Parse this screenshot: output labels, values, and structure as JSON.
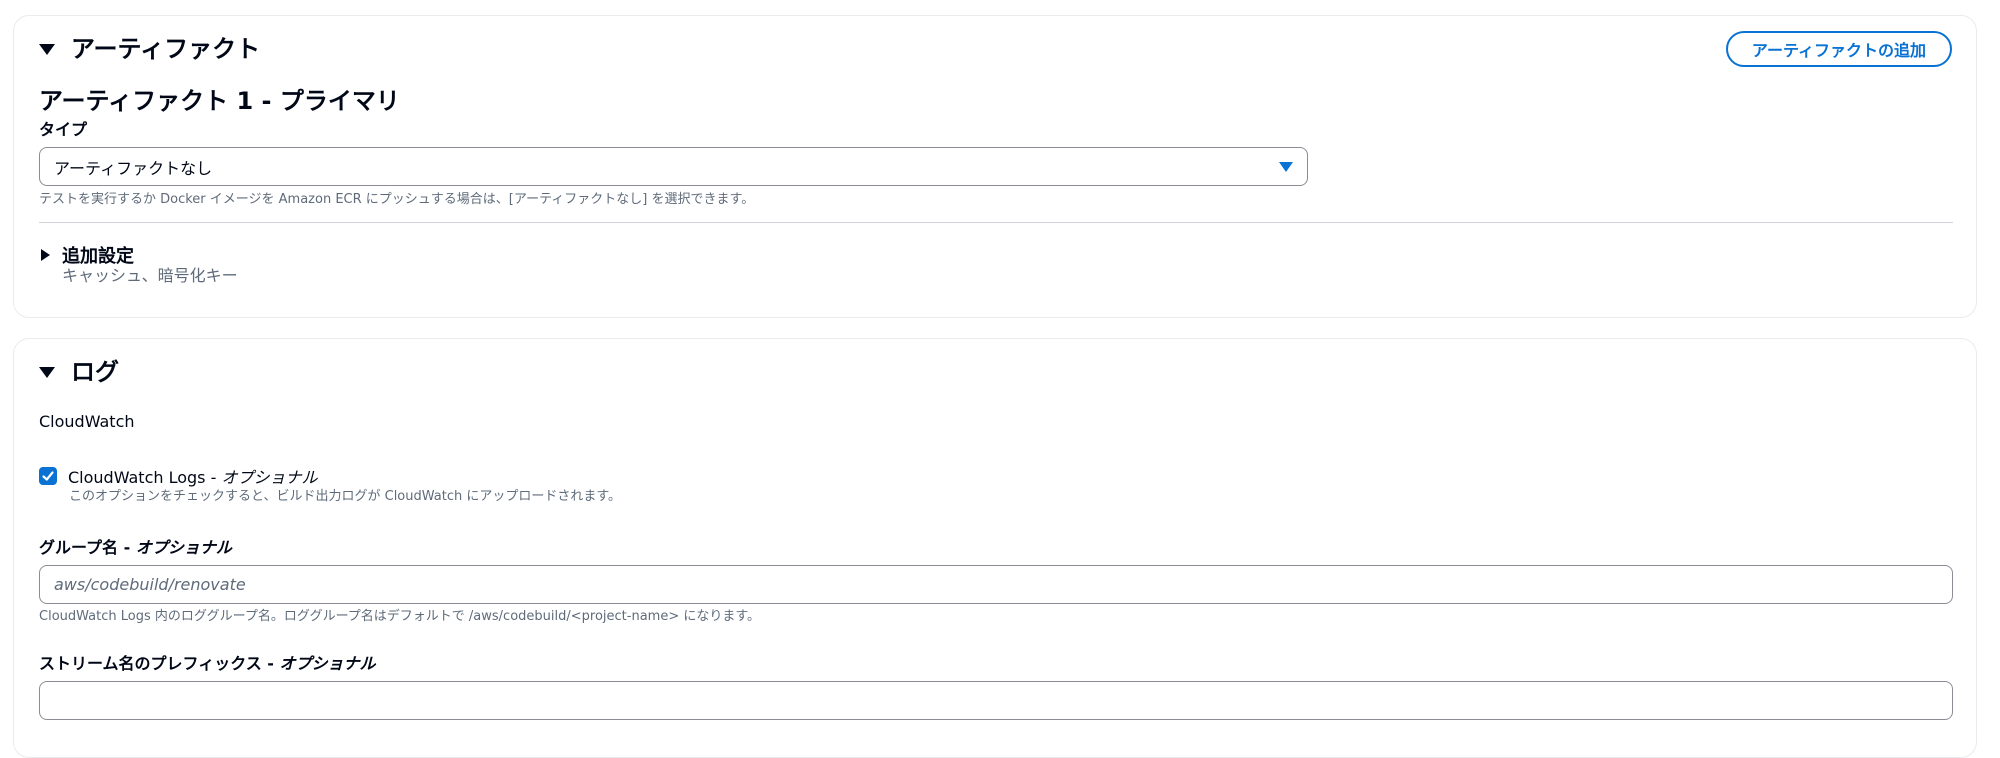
{
  "artifacts": {
    "section_title": "アーティファクト",
    "add_button_label": "アーティファクトの追加",
    "primary_heading": "アーティファクト 1 - プライマリ",
    "type_label": "タイプ",
    "type_selected": "アーティファクトなし",
    "type_description": "テストを実行するか Docker イメージを Amazon ECR にプッシュする場合は、[アーティファクトなし] を選択できます。",
    "additional_settings_title": "追加設定",
    "additional_settings_subtitle": "キャッシュ、暗号化キー"
  },
  "logs": {
    "section_title": "ログ",
    "cloudwatch_heading": "CloudWatch",
    "cloudwatch_logs_checkbox": {
      "checked": true,
      "label": "CloudWatch Logs - ",
      "label_optional": "オプショナル",
      "description": "このオプションをチェックすると、ビルド出力ログが CloudWatch にアップロードされます。"
    },
    "group_name": {
      "label": "グループ名 - ",
      "label_optional": "オプショナル",
      "placeholder": "aws/codebuild/renovate",
      "description": "CloudWatch Logs 内のロググループ名。ロググループ名はデフォルトで /aws/codebuild/<project-name> になります。"
    },
    "stream_prefix": {
      "label": "ストリーム名のプレフィックス - ",
      "label_optional": "オプショナル",
      "value": ""
    }
  },
  "colors": {
    "accent": "#0972d3",
    "text": "#000716",
    "muted": "#5f6b7a",
    "border": "#8c8c94"
  },
  "icons": [
    "caret-down-icon",
    "caret-right-icon",
    "select-caret-icon",
    "checkmark-icon"
  ]
}
